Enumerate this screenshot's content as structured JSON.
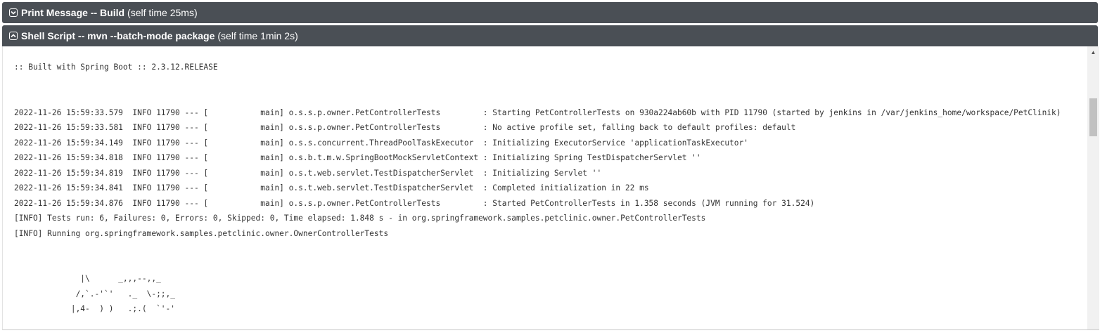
{
  "steps": [
    {
      "name": "Print Message -- Build",
      "time": "(self time 25ms)",
      "state": "collapsed"
    },
    {
      "name": "Shell Script -- mvn --batch-mode package",
      "time": "(self time 1min 2s)",
      "state": "expanded"
    }
  ],
  "log_lines": [
    ":: Built with Spring Boot :: 2.3.12.RELEASE",
    "",
    "",
    "2022-11-26 15:59:33.579  INFO 11790 --- [           main] o.s.s.p.owner.PetControllerTests         : Starting PetControllerTests on 930a224ab60b with PID 11790 (started by jenkins in /var/jenkins_home/workspace/PetClinik)",
    "2022-11-26 15:59:33.581  INFO 11790 --- [           main] o.s.s.p.owner.PetControllerTests         : No active profile set, falling back to default profiles: default",
    "2022-11-26 15:59:34.149  INFO 11790 --- [           main] o.s.s.concurrent.ThreadPoolTaskExecutor  : Initializing ExecutorService 'applicationTaskExecutor'",
    "2022-11-26 15:59:34.818  INFO 11790 --- [           main] o.s.b.t.m.w.SpringBootMockServletContext : Initializing Spring TestDispatcherServlet ''",
    "2022-11-26 15:59:34.819  INFO 11790 --- [           main] o.s.t.web.servlet.TestDispatcherServlet  : Initializing Servlet ''",
    "2022-11-26 15:59:34.841  INFO 11790 --- [           main] o.s.t.web.servlet.TestDispatcherServlet  : Completed initialization in 22 ms",
    "2022-11-26 15:59:34.876  INFO 11790 --- [           main] o.s.s.p.owner.PetControllerTests         : Started PetControllerTests in 1.358 seconds (JVM running for 31.524)",
    "[INFO] Tests run: 6, Failures: 0, Errors: 0, Skipped: 0, Time elapsed: 1.848 s - in org.springframework.samples.petclinic.owner.PetControllerTests",
    "[INFO] Running org.springframework.samples.petclinic.owner.OwnerControllerTests",
    "",
    "",
    "              |\\      _,,,--,,_",
    "             /,`.-'`'   ._  \\-;;,_",
    "            |,4-  ) )   .;.(  `'-'"
  ],
  "icons": {
    "collapsed": "chevron-down-icon",
    "expanded": "chevron-up-icon"
  }
}
